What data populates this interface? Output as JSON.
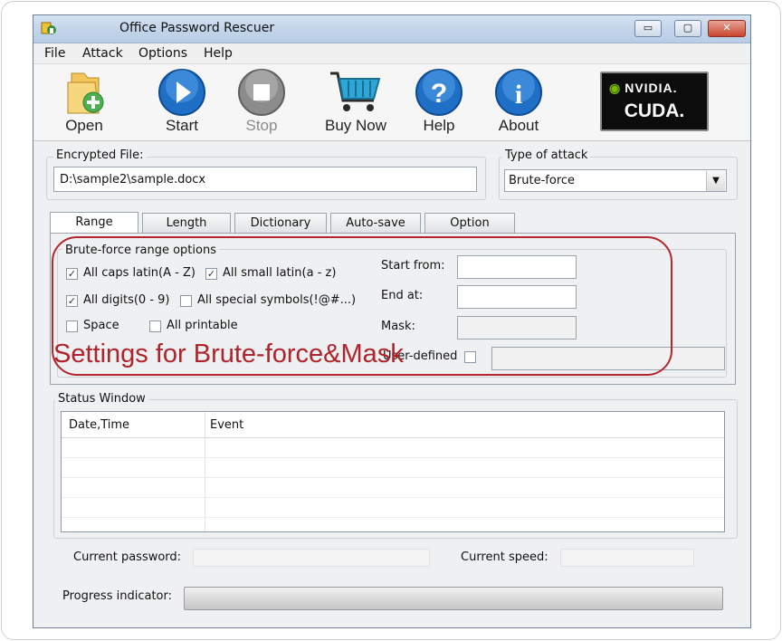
{
  "window": {
    "title": "Office Password Rescuer",
    "min": "▭",
    "max": "▢",
    "close": "✕"
  },
  "menu": [
    "File",
    "Attack",
    "Options",
    "Help"
  ],
  "toolbar": {
    "open": "Open",
    "start": "Start",
    "stop": "Stop",
    "buy": "Buy Now",
    "help": "Help",
    "about": "About",
    "cuda_brand": "NVIDIA.",
    "cuda_text": "CUDA."
  },
  "encrypted": {
    "label": "Encrypted File:",
    "value": "D:\\sample2\\sample.docx"
  },
  "attack": {
    "label": "Type of attack",
    "value": "Brute-force"
  },
  "tabs": [
    "Range",
    "Length",
    "Dictionary",
    "Auto-save",
    "Option"
  ],
  "range": {
    "group_title": "Brute-force range options",
    "options": [
      {
        "label": "All caps latin(A - Z)",
        "checked": true
      },
      {
        "label": "All small latin(a - z)",
        "checked": true
      },
      {
        "label": "All digits(0 - 9)",
        "checked": true
      },
      {
        "label": "All special symbols(!@#...)",
        "checked": false
      },
      {
        "label": "Space",
        "checked": false
      },
      {
        "label": "All printable",
        "checked": false
      }
    ],
    "start_from": "Start from:",
    "end_at": "End at:",
    "mask": "Mask:",
    "user_defined": "User-defined"
  },
  "annotation": "Settings for Brute-force&Mask",
  "status": {
    "title": "Status Window",
    "columns": [
      "Date,Time",
      "Event"
    ]
  },
  "bottom": {
    "current_password": "Current password:",
    "current_speed": "Current speed:",
    "progress_label": "Progress indicator:",
    "progress": 0
  },
  "colors": {
    "annotation": "#b0232a",
    "nvidia_green": "#76b900",
    "accent_blue": "#1f6fc7"
  }
}
